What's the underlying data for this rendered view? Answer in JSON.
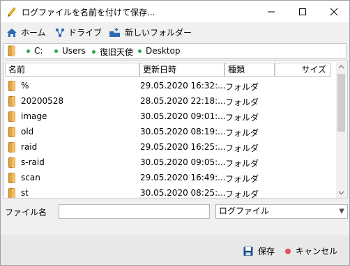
{
  "window": {
    "title": "ログファイルを名前を付けて保存...",
    "minimize_icon": "minimize-icon",
    "maximize_icon": "maximize-icon",
    "close_icon": "close-icon"
  },
  "toolbar": {
    "home_label": "ホーム",
    "drives_label": "ドライブ",
    "new_folder_label": "新しいフォルダー"
  },
  "path": {
    "segments": [
      "C:",
      "Users",
      "復旧天使",
      "Desktop"
    ]
  },
  "file_list": {
    "columns": [
      "名前",
      "更新日時",
      "種類",
      "サイズ"
    ],
    "rows": [
      {
        "name": "%",
        "modified": "29.05.2020 16:32:...",
        "type": "フォルダ"
      },
      {
        "name": "20200528",
        "modified": "28.05.2020 22:18:...",
        "type": "フォルダ"
      },
      {
        "name": "image",
        "modified": "30.05.2020 09:01:...",
        "type": "フォルダ"
      },
      {
        "name": "old",
        "modified": "30.05.2020 08:19:...",
        "type": "フォルダ"
      },
      {
        "name": "raid",
        "modified": "29.05.2020 16:25:...",
        "type": "フォルダ"
      },
      {
        "name": "s-raid",
        "modified": "30.05.2020 09:05:...",
        "type": "フォルダ"
      },
      {
        "name": "scan",
        "modified": "29.05.2020 16:49:...",
        "type": "フォルダ"
      },
      {
        "name": "st",
        "modified": "30.05.2020 08:25:...",
        "type": "フォルダ"
      }
    ]
  },
  "filename": {
    "label": "ファイル名",
    "value": ""
  },
  "filetype": {
    "selected": "ログファイル"
  },
  "buttons": {
    "save_label": "保存",
    "cancel_label": "キャンセル"
  },
  "colors": {
    "folder": "#e8a33d",
    "home_icon": "#2b6cb0",
    "cancel_dot": "#e05060",
    "path_dot": "#2ea44f"
  }
}
